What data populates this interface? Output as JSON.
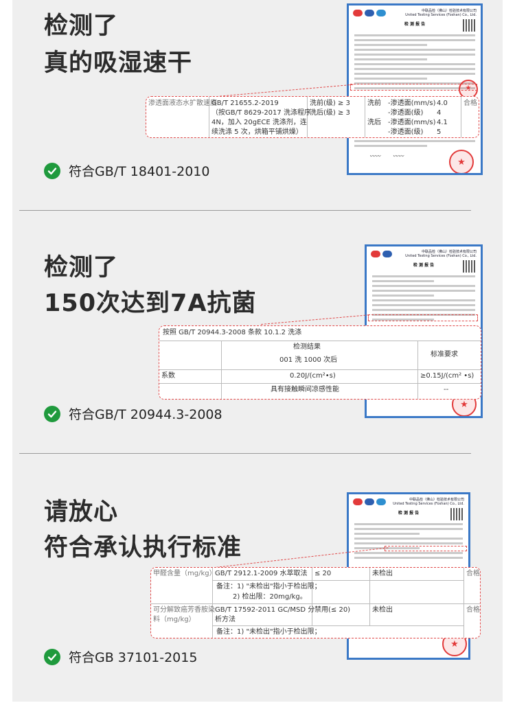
{
  "colors": {
    "panel": "#efefef",
    "check": "#1f9a3d",
    "report_border": "#3a78c6",
    "callout_dash": "#e04848",
    "seal": "#e23a3a"
  },
  "sections": [
    {
      "title_line1": "检测了",
      "title_line2": "真的吸湿速干",
      "standard": "符合GB/T 18401-2010",
      "icon": "check-circle-icon",
      "callout": {
        "item": "渗透面液态水扩散速度",
        "method_1": "GB/T 21655.2-2019",
        "method_2": "（按GB/T 8629-2017 洗涤程序",
        "method_3": "4N，加入 20gECE 洗涤剂，连",
        "method_4": "续洗涤 5 次，烘箱平铺烘燥）",
        "req_1": "洗前(级) ≥ 3",
        "req_2": "洗后(级) ≥ 3",
        "res_pre": "洗前",
        "res_pre_1": "-渗透面(mm/s)",
        "res_pre_1v": "4.0",
        "res_pre_2": "-渗透面(级)",
        "res_pre_2v": "4",
        "res_post": "洗后",
        "res_post_1": "-渗透面(mm/s)",
        "res_post_1v": "4.1",
        "res_post_2": "-渗透面(级)",
        "res_post_2v": "5",
        "verdict": "合格"
      }
    },
    {
      "title_line1": "检测了",
      "title_line2": "150次达到7A抗菌",
      "standard": "符合GB/T 20944.3-2008",
      "icon": "check-circle-icon",
      "callout": {
        "head": "按照 GB/T 20944.3-2008   条款 10.1.2 洗涤",
        "col_result": "检测结果",
        "col_result_sub": "001 洗 1000 次后",
        "col_req": "标准要求",
        "row_label": "系数",
        "row_value": "0.20J/(cm²•s)",
        "row_req": "≥0.15J/(cm² •s)",
        "row2_value": "具有接触瞬间凉感性能",
        "row2_req": "--"
      }
    },
    {
      "title_line1": "请放心",
      "title_line2": "符合承认执行标准",
      "standard": "符合GB 37101-2015",
      "icon": "check-circle-icon",
      "callout": {
        "r1_item": "甲醛含量（mg/kg）",
        "r1_method": "GB/T 2912.1-2009 水萃取法",
        "r1_req": "≤ 20",
        "r1_res": "未检出",
        "r1_verdict": "合格",
        "r1_note_1": "备注：1) \"未检出\"指小于检出限；",
        "r1_note_2": "2) 检出限：20mg/kg。",
        "r2_item_1": "可分解致癌芳香胺染",
        "r2_item_2": "料（mg/kg）",
        "r2_method_1": "GB/T 17592-2011 GC/MSD 分",
        "r2_method_2": "析方法",
        "r2_req": "禁用(≤ 20)",
        "r2_res": "未检出",
        "r2_verdict": "合格",
        "r2_note": "备注：1) \"未检出\"指小于检出限；"
      }
    }
  ],
  "report": {
    "title": "检 测 报 告",
    "header_1": "中联品检（佛山）检验技术有限公司",
    "header_2": "United Testing Services (Foshan) Co., Ltd.",
    "seal_icon": "red-seal-stamp-icon",
    "qr_icon": "qr-code-icon"
  }
}
